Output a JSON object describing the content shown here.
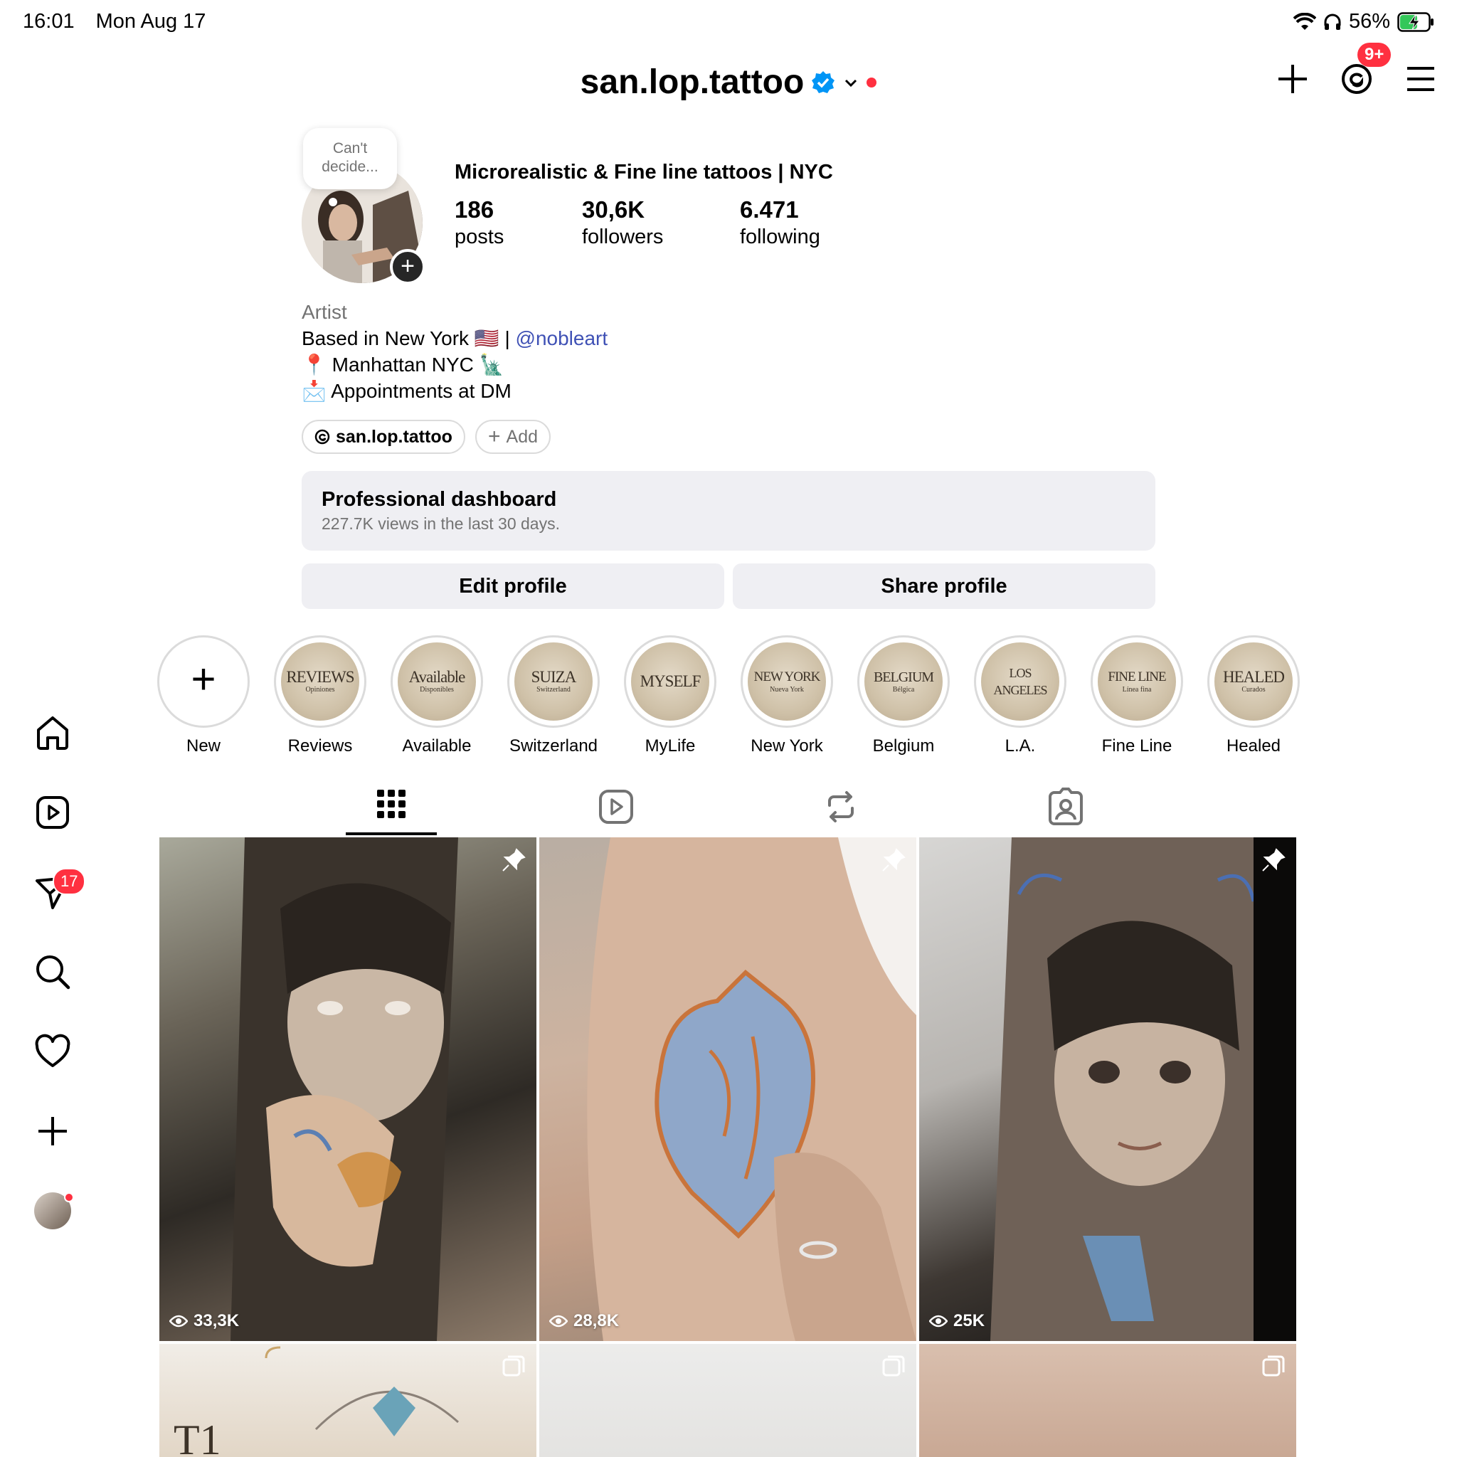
{
  "status_bar": {
    "time": "16:01",
    "date": "Mon Aug 17",
    "battery": "56%"
  },
  "header": {
    "username": "san.lop.tattoo",
    "notification_badge": "9+"
  },
  "profile": {
    "note": "Can't decide...",
    "display_name": "Microrealistic & Fine line tattoos | NYC",
    "stats": [
      {
        "value": "186",
        "label": "posts"
      },
      {
        "value": "30,6K",
        "label": "followers"
      },
      {
        "value": "6.471",
        "label": "following"
      }
    ],
    "bio": {
      "category": "Artist",
      "line1_text": "Based in New York 🇺🇸 | ",
      "line1_mention": "@nobleart",
      "line2": "📍 Manhattan NYC 🗽",
      "line3": "📩 Appointments at DM"
    },
    "threads_chip": "san.lop.tattoo",
    "add_chip": "Add"
  },
  "dashboard": {
    "title": "Professional dashboard",
    "subtitle": "227.7K views in the last 30 days."
  },
  "buttons": {
    "edit": "Edit profile",
    "share": "Share profile"
  },
  "highlights": [
    {
      "label": "New",
      "cover1": "",
      "cover2": ""
    },
    {
      "label": "Reviews",
      "cover1": "REVIEWS",
      "cover2": "Opiniones"
    },
    {
      "label": "Available",
      "cover1": "Available",
      "cover2": "Disponibles"
    },
    {
      "label": "Switzerland",
      "cover1": "SUIZA",
      "cover2": "Switzerland"
    },
    {
      "label": "MyLife",
      "cover1": "MYSELF",
      "cover2": ""
    },
    {
      "label": "New York",
      "cover1": "NEW YORK",
      "cover2": "Nueva York"
    },
    {
      "label": "Belgium",
      "cover1": "BELGIUM",
      "cover2": "Bélgica"
    },
    {
      "label": "L.A.",
      "cover1": "LOS ANGELES",
      "cover2": ""
    },
    {
      "label": "Fine Line",
      "cover1": "FINE LINE",
      "cover2": "Línea fina"
    },
    {
      "label": "Healed",
      "cover1": "HEALED",
      "cover2": "Curados"
    }
  ],
  "nav": {
    "messages_badge": "17"
  },
  "posts": [
    {
      "views": "33,3K"
    },
    {
      "views": "28,8K"
    },
    {
      "views": "25K"
    }
  ],
  "colors": {
    "accent_red": "#ff3040",
    "verified_blue": "#0095f6",
    "mention_blue": "#3f51b5",
    "button_gray": "#efeff3"
  }
}
